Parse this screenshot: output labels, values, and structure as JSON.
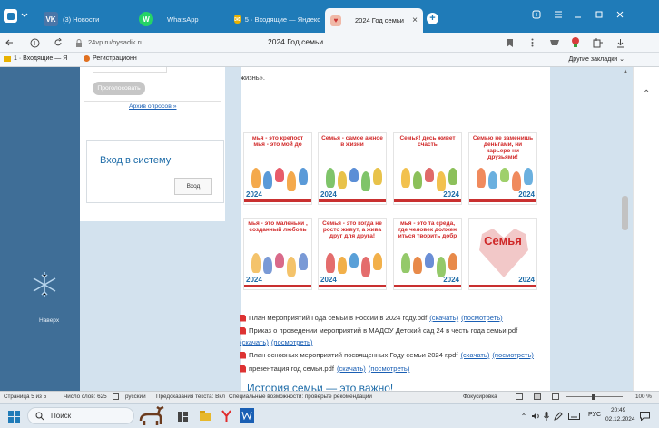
{
  "browser": {
    "tabs": [
      {
        "label": "(3) Новости",
        "icon": "vk-icon",
        "color": "#4a76a8",
        "glyph": "VK"
      },
      {
        "label": "WhatsApp",
        "icon": "whatsapp-icon",
        "color": "#25d366",
        "glyph": "W"
      },
      {
        "label": "5 · Входящие — Яндекс П",
        "icon": "mail-icon",
        "color": "#e8b100",
        "glyph": "✉"
      },
      {
        "label": "2024 Год семьи",
        "icon": "site-icon",
        "color": "#d24d3a",
        "glyph": "♥"
      }
    ],
    "close_tab": "×",
    "new_tab": "+",
    "address": "24vp.ru/oysadik.ru",
    "page_title": "2024 Год семьи",
    "bookmarks": [
      {
        "label": "1 · Входящие — Я",
        "icon": "mail-icon"
      },
      {
        "label": "Регистрационн",
        "icon": "registration-icon"
      }
    ],
    "other_bookmarks": "Другие закладки"
  },
  "sidebar": {
    "vote_button": "Проголосовать",
    "archive_link": "Архив опросов »",
    "login_title": "Вход в систему",
    "login_button": "Вход",
    "up_label": "Наверх"
  },
  "main": {
    "top_text": "жизнь».",
    "posters": [
      {
        "title": "мья - это крепост мья - это мой до",
        "color": "#d12a2a"
      },
      {
        "title": "Семья - самое ажное в жизни",
        "color": "#d12a2a"
      },
      {
        "title": "Семья! десь живет счасть",
        "color": "#d12a2a"
      },
      {
        "title": "Семью не заменишь деньгами, ни карьеро ни друзьями!",
        "color": "#d12a2a"
      },
      {
        "title": "мья - это маленьки , созданный любовь",
        "color": "#d12a2a"
      },
      {
        "title": "Семья - это когда не росто живут, а жива друг для друга!",
        "color": "#d12a2a"
      },
      {
        "title": "мья - это та среда, где человек должен иться творить добр",
        "color": "#d12a2a"
      },
      {
        "title": "Семья",
        "color": "#c22"
      }
    ],
    "poster_year": "2024",
    "documents": [
      {
        "text": "План мероприятий Года семьи в России в 2024 году.pdf",
        "dl": "(скачать)",
        "view": "(посмотреть)"
      },
      {
        "text": "Приказ о проведении мероприятий в МАДОУ Детский сад 24 в честь года семьи.pdf",
        "dl": "(скачать)",
        "view": "(посмотреть)"
      },
      {
        "text": "План основных мероприятий посвященных Году семьи 2024 г.pdf",
        "dl": "(скачать)",
        "view": "(посмотреть)"
      },
      {
        "text": "презентация год семьи.pdf",
        "dl": "(скачать)",
        "view": "(посмотреть)"
      }
    ],
    "bottom_heading": "История семьи — это важно!"
  },
  "word_status": {
    "page": "Страница 5 из 5",
    "words": "Число слов: 625",
    "lang": "русский",
    "predict": "Предсказания текста: Вкл",
    "access": "Специальные возможности: проверьте рекомендации",
    "focus": "Фокусировка",
    "zoom": "100 %"
  },
  "taskbar": {
    "search_placeholder": "Поиск",
    "lang": "РУС",
    "time": "20:49",
    "date": "02.12.2024"
  }
}
